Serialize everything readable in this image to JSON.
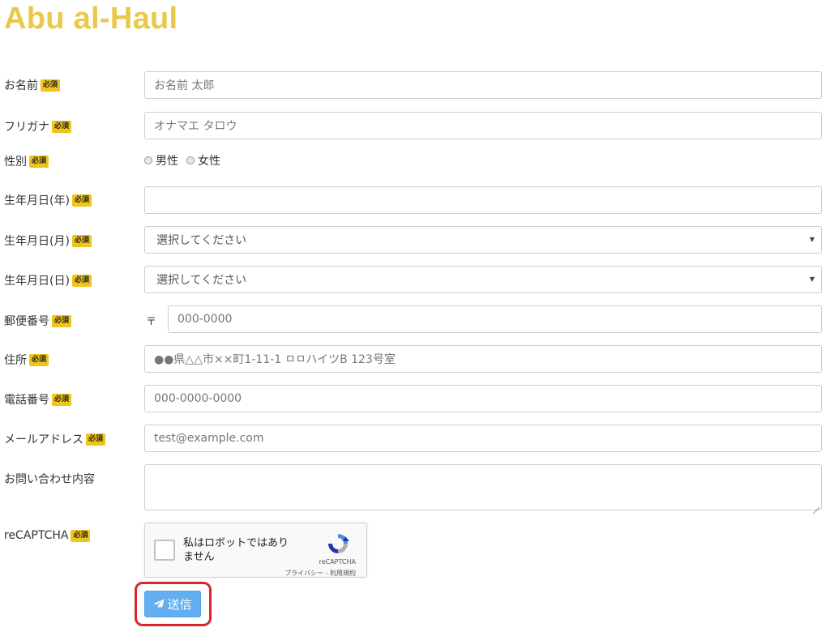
{
  "site": {
    "title": "Abu al-Haul"
  },
  "required_badge": "必須",
  "fields": {
    "name": {
      "label": "お名前",
      "placeholder": "お名前 太郎"
    },
    "furigana": {
      "label": "フリガナ",
      "placeholder": "オナマエ タロウ"
    },
    "gender": {
      "label": "性別",
      "options": [
        "男性",
        "女性"
      ]
    },
    "birth_year": {
      "label": "生年月日(年)",
      "value": ""
    },
    "birth_month": {
      "label": "生年月日(月)",
      "value": "選択してください"
    },
    "birth_day": {
      "label": "生年月日(日)",
      "value": "選択してください"
    },
    "zip": {
      "label": "郵便番号",
      "prefix": "〒",
      "placeholder": "000-0000"
    },
    "address": {
      "label": "住所",
      "placeholder": "●●県△△市××町1-11-1 ㅁㅁハイツB 123号室"
    },
    "phone": {
      "label": "電話番号",
      "placeholder": "000-0000-0000"
    },
    "email": {
      "label": "メールアドレス",
      "placeholder": "test@example.com"
    },
    "inquiry": {
      "label": "お問い合わせ内容"
    },
    "recaptcha": {
      "label": "reCAPTCHA",
      "checkbox_text": "私はロボットではありません",
      "brand": "reCAPTCHA",
      "links": "プライバシー - 利用規約"
    }
  },
  "submit": {
    "label": "送信",
    "icon": "paper-plane-icon"
  },
  "colors": {
    "title": "#e8c94a",
    "badge": "#f0c419",
    "submit": "#62aef0",
    "highlight": "#d9262e"
  }
}
